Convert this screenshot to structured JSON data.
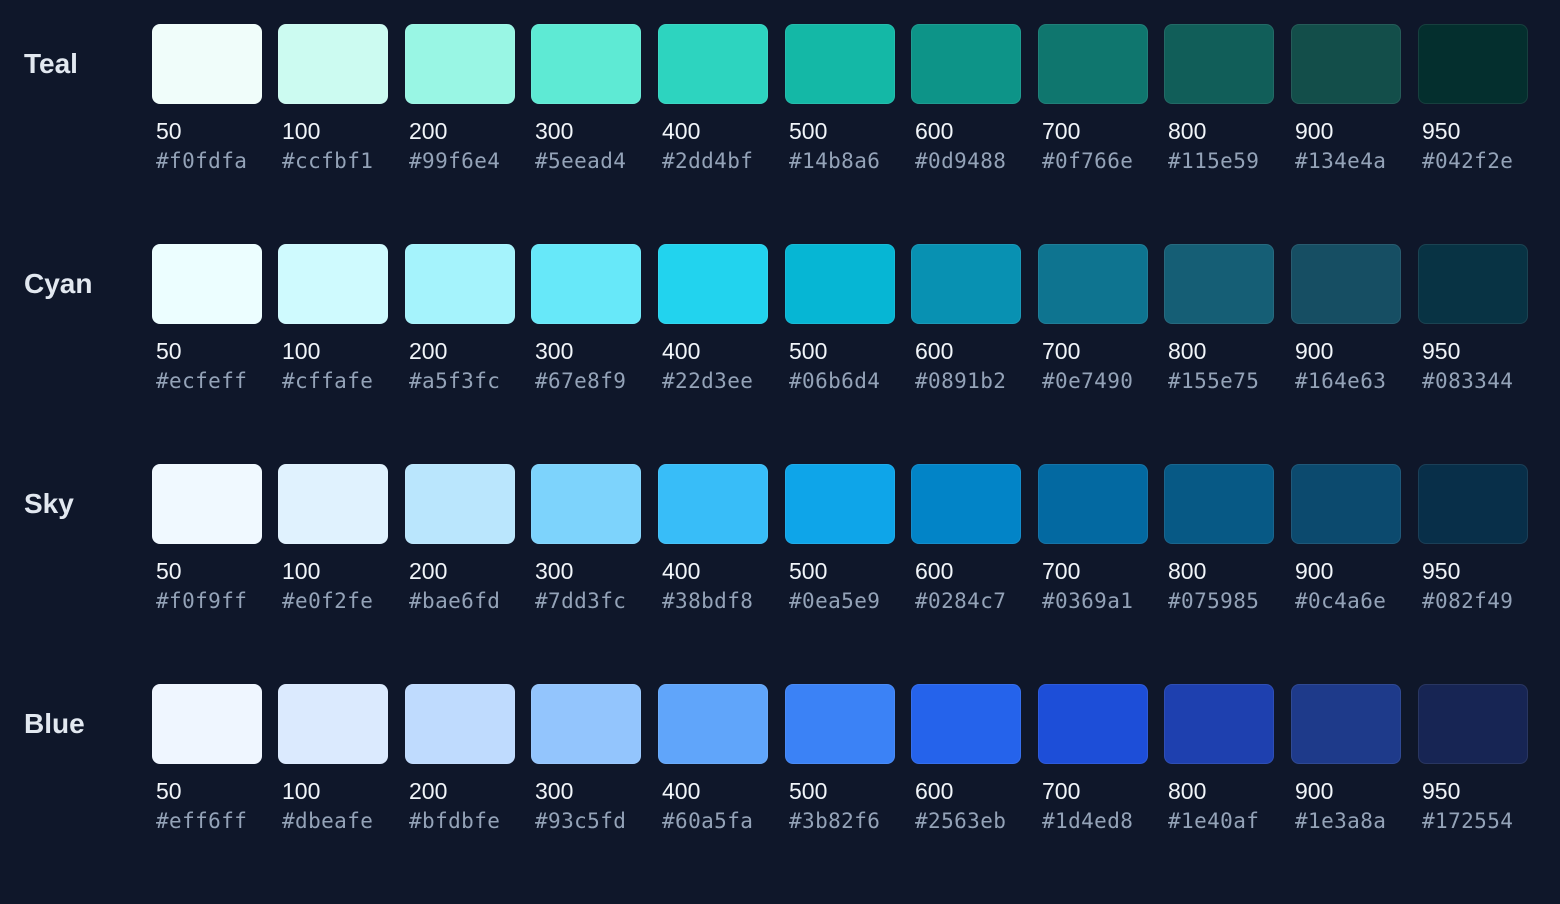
{
  "palettes": [
    {
      "name": "Teal",
      "swatches": [
        {
          "shade": "50",
          "hex": "#f0fdfa"
        },
        {
          "shade": "100",
          "hex": "#ccfbf1"
        },
        {
          "shade": "200",
          "hex": "#99f6e4"
        },
        {
          "shade": "300",
          "hex": "#5eead4"
        },
        {
          "shade": "400",
          "hex": "#2dd4bf"
        },
        {
          "shade": "500",
          "hex": "#14b8a6"
        },
        {
          "shade": "600",
          "hex": "#0d9488"
        },
        {
          "shade": "700",
          "hex": "#0f766e"
        },
        {
          "shade": "800",
          "hex": "#115e59"
        },
        {
          "shade": "900",
          "hex": "#134e4a"
        },
        {
          "shade": "950",
          "hex": "#042f2e"
        }
      ]
    },
    {
      "name": "Cyan",
      "swatches": [
        {
          "shade": "50",
          "hex": "#ecfeff"
        },
        {
          "shade": "100",
          "hex": "#cffafe"
        },
        {
          "shade": "200",
          "hex": "#a5f3fc"
        },
        {
          "shade": "300",
          "hex": "#67e8f9"
        },
        {
          "shade": "400",
          "hex": "#22d3ee"
        },
        {
          "shade": "500",
          "hex": "#06b6d4"
        },
        {
          "shade": "600",
          "hex": "#0891b2"
        },
        {
          "shade": "700",
          "hex": "#0e7490"
        },
        {
          "shade": "800",
          "hex": "#155e75"
        },
        {
          "shade": "900",
          "hex": "#164e63"
        },
        {
          "shade": "950",
          "hex": "#083344"
        }
      ]
    },
    {
      "name": "Sky",
      "swatches": [
        {
          "shade": "50",
          "hex": "#f0f9ff"
        },
        {
          "shade": "100",
          "hex": "#e0f2fe"
        },
        {
          "shade": "200",
          "hex": "#bae6fd"
        },
        {
          "shade": "300",
          "hex": "#7dd3fc"
        },
        {
          "shade": "400",
          "hex": "#38bdf8"
        },
        {
          "shade": "500",
          "hex": "#0ea5e9"
        },
        {
          "shade": "600",
          "hex": "#0284c7"
        },
        {
          "shade": "700",
          "hex": "#0369a1"
        },
        {
          "shade": "800",
          "hex": "#075985"
        },
        {
          "shade": "900",
          "hex": "#0c4a6e"
        },
        {
          "shade": "950",
          "hex": "#082f49"
        }
      ]
    },
    {
      "name": "Blue",
      "swatches": [
        {
          "shade": "50",
          "hex": "#eff6ff"
        },
        {
          "shade": "100",
          "hex": "#dbeafe"
        },
        {
          "shade": "200",
          "hex": "#bfdbfe"
        },
        {
          "shade": "300",
          "hex": "#93c5fd"
        },
        {
          "shade": "400",
          "hex": "#60a5fa"
        },
        {
          "shade": "500",
          "hex": "#3b82f6"
        },
        {
          "shade": "600",
          "hex": "#2563eb"
        },
        {
          "shade": "700",
          "hex": "#1d4ed8"
        },
        {
          "shade": "800",
          "hex": "#1e40af"
        },
        {
          "shade": "900",
          "hex": "#1e3a8a"
        },
        {
          "shade": "950",
          "hex": "#172554"
        }
      ]
    }
  ]
}
